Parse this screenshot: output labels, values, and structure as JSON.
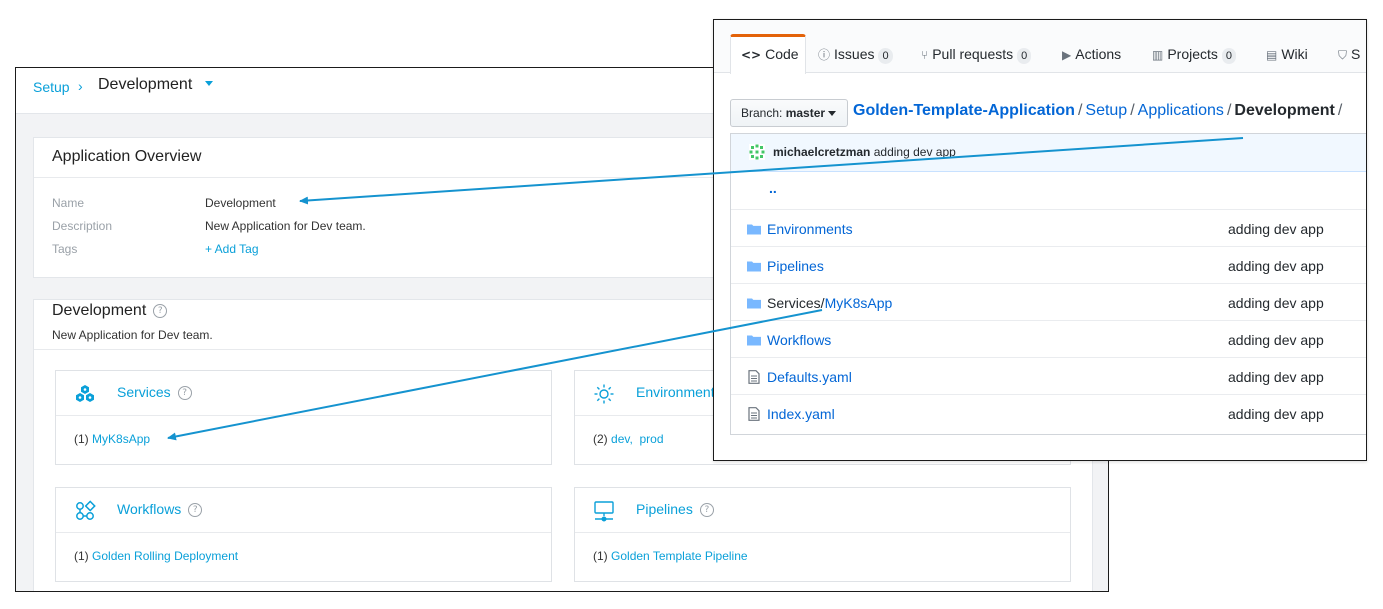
{
  "harness": {
    "breadcrumb": {
      "parent": "Setup",
      "separator": "›",
      "current": "Development"
    },
    "overview": {
      "title": "Application Overview",
      "fields": [
        {
          "label": "Name",
          "value": "Development"
        },
        {
          "label": "Description",
          "value": "New Application for Dev team."
        },
        {
          "label": "Tags",
          "value": "+ Add Tag"
        }
      ]
    },
    "app": {
      "title": "Development",
      "help": "?",
      "description": "New Application for Dev team.",
      "tiles": [
        {
          "title": "Services",
          "icon": "services-icon",
          "count": "(1)",
          "items": [
            "MyK8sApp"
          ]
        },
        {
          "title": "Environments",
          "icon": "sun-icon",
          "count": "(2)",
          "items": [
            "dev,",
            "prod"
          ]
        },
        {
          "title": "Workflows",
          "icon": "workflows-icon",
          "count": "(1)",
          "items": [
            "Golden Rolling Deployment"
          ]
        },
        {
          "title": "Pipelines",
          "icon": "pipelines-icon",
          "count": "(1)",
          "items": [
            "Golden Template Pipeline"
          ]
        }
      ]
    },
    "accent": "#0aa0d9"
  },
  "github": {
    "tabs": [
      {
        "label": "Code",
        "icon": "<>"
      },
      {
        "label": "Issues",
        "count": "0"
      },
      {
        "label": "Pull requests",
        "count": "0"
      },
      {
        "label": "Actions"
      },
      {
        "label": "Projects",
        "count": "0"
      },
      {
        "label": "Wiki"
      },
      {
        "label": "S"
      }
    ],
    "branch": {
      "prefix": "Branch:",
      "name": "master"
    },
    "path": {
      "repo": "Golden-Template-Application",
      "dirs": [
        "Setup",
        "Applications"
      ],
      "current": "Development",
      "sep": "/"
    },
    "commit": {
      "author": "michaelcretzman",
      "message": "adding dev app"
    },
    "updir": "..",
    "files": [
      {
        "type": "folder",
        "name": "Environments",
        "message": "adding dev app"
      },
      {
        "type": "folder",
        "name": "Pipelines",
        "message": "adding dev app"
      },
      {
        "type": "folder",
        "prefix": "Services/",
        "name": "MyK8sApp",
        "message": "adding dev app"
      },
      {
        "type": "folder",
        "name": "Workflows",
        "message": "adding dev app"
      },
      {
        "type": "file",
        "name": "Defaults.yaml",
        "message": "adding dev app"
      },
      {
        "type": "file",
        "name": "Index.yaml",
        "message": "adding dev app"
      }
    ],
    "accent": "#0366d6",
    "active_tab_color": "#e36209"
  },
  "arrow_color": "#1593cf"
}
